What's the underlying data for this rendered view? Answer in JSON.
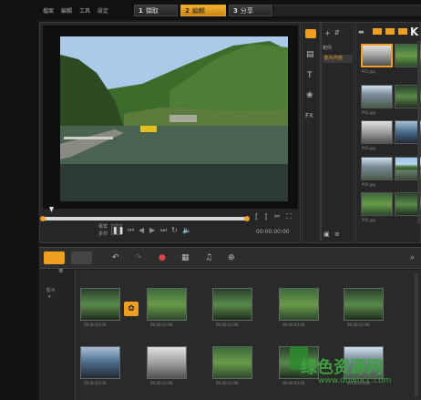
{
  "menu": [
    "檔案",
    "編輯",
    "工具",
    "設定"
  ],
  "steps": [
    {
      "num": "1",
      "label": "擷取"
    },
    {
      "num": "2",
      "label": "編輯"
    },
    {
      "num": "3",
      "label": "分享"
    }
  ],
  "library": {
    "tab_labels": [
      "範例",
      "影片內容"
    ],
    "thumb_labels": [
      "P01.jpg",
      "P02.jpg",
      "P03.jpg",
      "P04.jpg",
      "P05.jpg",
      "P06.jpg",
      "P07.jpg",
      "P08.jpg"
    ]
  },
  "player": {
    "mode_labels": [
      "專案",
      "素材"
    ],
    "timecode": "00:00:00:00"
  },
  "timeline": {
    "track_label": "影片",
    "clip_timecodes": [
      "00:00:03:00",
      "00:00:03:00",
      "00:00:03:00",
      "00:00:03:00",
      "00:00:03:00",
      "00:00:03:00",
      "00:00:03:00",
      "00:00:03:00",
      "00:00:03:00",
      "00:00:03:00"
    ]
  },
  "watermark": {
    "text": "绿色资源网",
    "url": "www.downcc.com"
  },
  "colors": {
    "accent": "#f0a020",
    "panel": "#262626",
    "background": "#1a1a1a"
  }
}
